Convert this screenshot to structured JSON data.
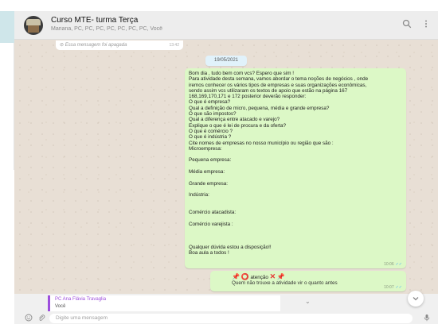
{
  "header": {
    "title": "Curso MTE- turma  Terça",
    "members": "Mariana, PC, PC, PC, PC, PC, PC, PC, Você",
    "search_icon": "search-icon",
    "menu_icon": "menu-kebab-icon"
  },
  "chat": {
    "deleted": {
      "text": "Essa mensagem foi apagada",
      "time": "13:42"
    },
    "date": "19/05/2021",
    "message": {
      "lines": [
        "Bom dia , tudo bem com vcs? Espero que sim !",
        "Para atividade desta semana, vamos abordar o tema noções de negócios , onde",
        "iremos conhecer os vários tipos de empresas e suas organizações econômicas,",
        "sendo assim vcs utilizaram os textos de apoio que estão na página 167",
        "168,169,170,171 e 172 posterior deverão responder:",
        "O que é empresa?",
        " Qual a definição de micro, pequena, média e grande empresa?",
        "O que são impostos?",
        "Qual a diferença entre atacado e varejo?",
        "Explique o que é lei de procura e da oferta?",
        "O que é comércio ?",
        "O que é indústria ?",
        "Cite nomes de empresas no nosso município ou região que são :",
        "Microempresa:",
        "",
        "Pequena empresa:",
        "",
        "Média empresa:",
        "",
        "Grande empresa:",
        "",
        "Indústria:",
        "",
        "",
        "Comércio atacadista:",
        "",
        " Comércio varejista :",
        "",
        "",
        "",
        "Qualquer dúvida estou a disposição!!",
        "Boa aula a todos !"
      ],
      "time": "10:06"
    },
    "second_message": {
      "line1": "atenção",
      "line2": "Quem não trouxe a atividade vir o quanto antes",
      "time": "10:07"
    }
  },
  "reply": {
    "author": "PC Ana Flávia Travaglia",
    "you": "Você"
  },
  "compose": {
    "placeholder": "Digite uma mensagem"
  },
  "colors": {
    "bubble_out": "#dcf8c6",
    "header_bg": "#ededed",
    "chat_bg": "#e8dfd5",
    "reply_accent": "#9d4edd",
    "tick_blue": "#4fb3f0"
  }
}
